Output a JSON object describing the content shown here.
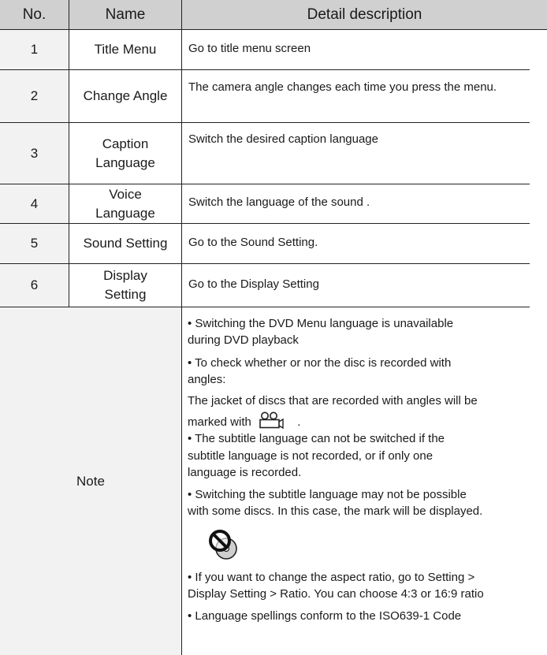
{
  "header": {
    "no": "No.",
    "name": "Name",
    "detail": "Detail description"
  },
  "rows": [
    {
      "no": "1",
      "name": "Title Menu",
      "desc": "Go to title menu screen"
    },
    {
      "no": "2",
      "name": "Change Angle",
      "desc": "The camera angle changes each time you press the menu."
    },
    {
      "no": "3",
      "name": "Caption Language",
      "desc": "Switch  the desired caption language"
    },
    {
      "no": "4",
      "name": "Voice Language",
      "desc": "Switch the language of the sound ."
    },
    {
      "no": "5",
      "name": "Sound Setting",
      "desc": "Go to the Sound Setting."
    },
    {
      "no": "6",
      "name": "Display Setting",
      "desc": "Go to the Display Setting"
    }
  ],
  "note": {
    "label": "Note",
    "lines": {
      "l1": "• Switching the DVD Menu language is unavailable",
      "l2": "during DVD playback",
      "l3": "• To check whether or nor the disc is recorded with",
      "l4": "angles:",
      "l5": "The jacket of discs that are recorded with angles will be",
      "l6": "marked with",
      "l6b": ".",
      "l7": "•  The subtitle language can not be switched if the",
      "l8": "subtitle language is not recorded, or if only one",
      "l9": "language is recorded.",
      "l10": "•  Switching the subtitle language may not be possible",
      "l11": "with some discs. In this case, the mark will be displayed.",
      "l12": "• If you want to change the aspect ratio, go to Setting >",
      "l13": "Display Setting > Ratio.  You can choose 4:3 or 16:9 ratio",
      "l14": "• Language spellings conform to the ISO639-1 Code"
    },
    "icons": {
      "angle": "camera-angle-icon",
      "prohibited": "prohibited-disc-icon"
    }
  }
}
